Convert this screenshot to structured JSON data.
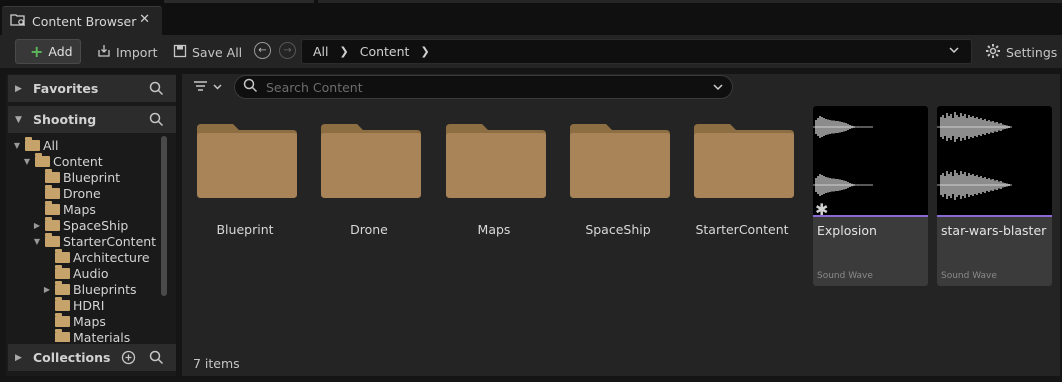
{
  "tab": {
    "title": "Content Browser",
    "close": "✕"
  },
  "toolbar": {
    "add_label": "Add",
    "import_label": "Import",
    "saveall_label": "Save All",
    "path": [
      "All",
      "Content"
    ],
    "settings_label": "Settings"
  },
  "sidebar": {
    "favorites_label": "Favorites",
    "project_label": "Shooting",
    "collections_label": "Collections",
    "tree": [
      {
        "label": "All",
        "depth": 0,
        "arrow": "▼",
        "selected": false
      },
      {
        "label": "Content",
        "depth": 1,
        "arrow": "▼",
        "selected": true
      },
      {
        "label": "Blueprint",
        "depth": 2,
        "arrow": "",
        "selected": false
      },
      {
        "label": "Drone",
        "depth": 2,
        "arrow": "",
        "selected": false
      },
      {
        "label": "Maps",
        "depth": 2,
        "arrow": "",
        "selected": false
      },
      {
        "label": "SpaceShip",
        "depth": 2,
        "arrow": "▶",
        "selected": false
      },
      {
        "label": "StarterContent",
        "depth": 2,
        "arrow": "▼",
        "selected": false
      },
      {
        "label": "Architecture",
        "depth": 3,
        "arrow": "",
        "selected": false
      },
      {
        "label": "Audio",
        "depth": 3,
        "arrow": "",
        "selected": false
      },
      {
        "label": "Blueprints",
        "depth": 3,
        "arrow": "▶",
        "selected": false
      },
      {
        "label": "HDRI",
        "depth": 3,
        "arrow": "",
        "selected": false
      },
      {
        "label": "Maps",
        "depth": 3,
        "arrow": "",
        "selected": false
      },
      {
        "label": "Materials",
        "depth": 3,
        "arrow": "",
        "selected": false
      }
    ]
  },
  "search": {
    "placeholder": "Search Content"
  },
  "folders": [
    "Blueprint",
    "Drone",
    "Maps",
    "SpaceShip",
    "StarterContent"
  ],
  "assets": [
    {
      "name": "Explosion",
      "type": "Sound Wave"
    },
    {
      "name": "star-wars-blaster",
      "type": "Sound Wave"
    }
  ],
  "status": {
    "item_count": "7 items"
  },
  "colors": {
    "folder": "#c5a36b",
    "selection": "#3d5a78",
    "sound_wave_accent": "#8a6bd6",
    "add_plus": "#5cb85c"
  }
}
